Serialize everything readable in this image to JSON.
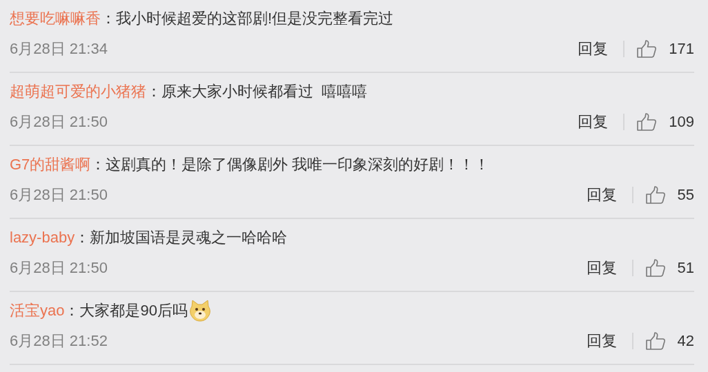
{
  "comments": [
    {
      "user": "想要吃嘛嘛香",
      "text": "：我小时候超爱的这部剧!但是没完整看完过",
      "time": "6月28日 21:34",
      "reply": "回复",
      "likes": "171"
    },
    {
      "user": "超萌超可爱的小猪猪",
      "text": "：原来大家小时候都看过  嘻嘻嘻",
      "time": "6月28日 21:50",
      "reply": "回复",
      "likes": "109"
    },
    {
      "user": "G7的甜酱啊",
      "text": "：这剧真的！是除了偶像剧外 我唯一印象深刻的好剧！！！",
      "time": "6月28日 21:50",
      "reply": "回复",
      "likes": "55"
    },
    {
      "user": "lazy-baby",
      "text": "：新加坡国语是灵魂之一哈哈哈",
      "time": "6月28日 21:50",
      "reply": "回复",
      "likes": "51"
    },
    {
      "user": "活宝yao",
      "text": "：大家都是90后吗",
      "has_emoji": true,
      "time": "6月28日 21:52",
      "reply": "回复",
      "likes": "42"
    }
  ]
}
